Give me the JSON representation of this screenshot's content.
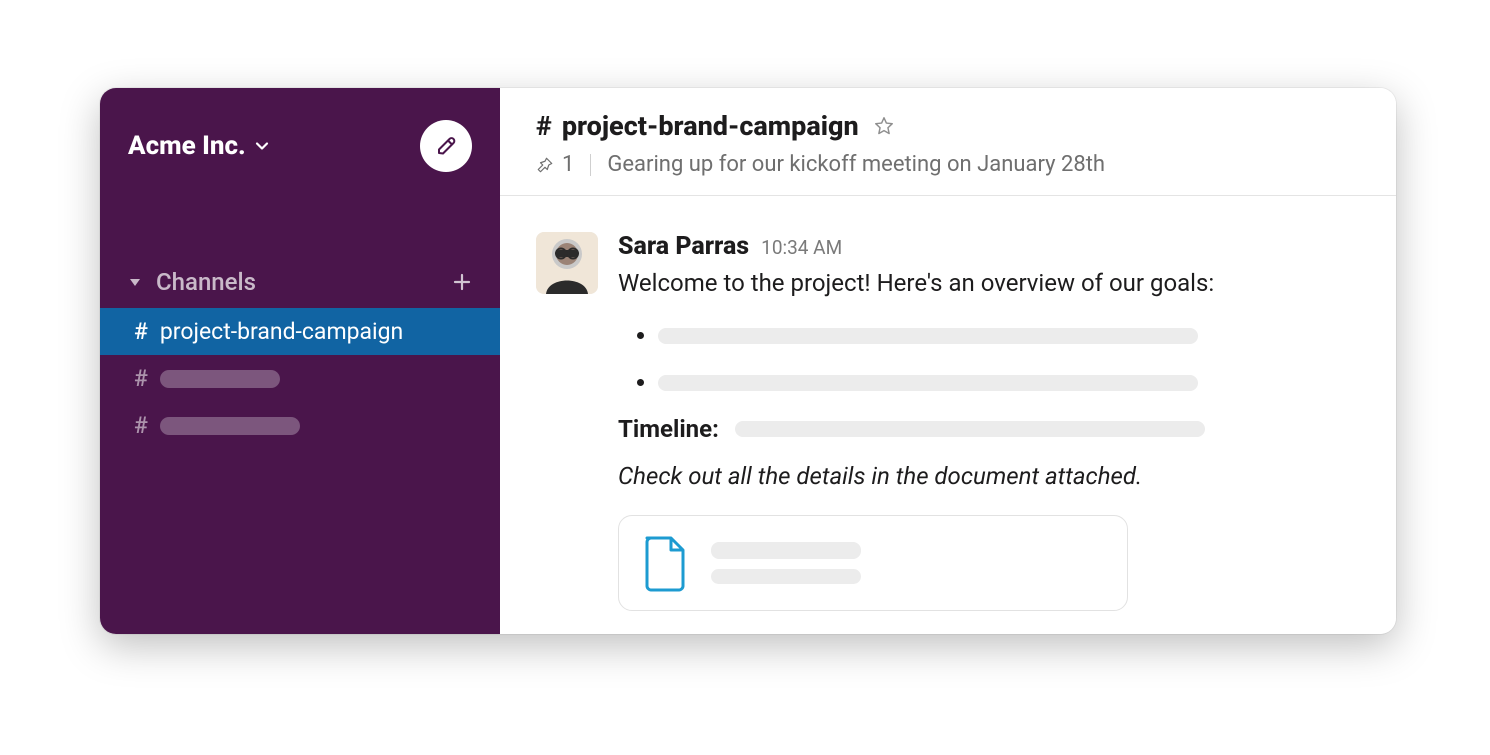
{
  "workspace": {
    "name": "Acme Inc."
  },
  "sidebar": {
    "section_label": "Channels",
    "channels": [
      {
        "name": "project-brand-campaign",
        "active": true
      }
    ]
  },
  "channel_header": {
    "name": "project-brand-campaign",
    "pinned_count": "1",
    "topic": "Gearing up for our kickoff meeting on January 28th"
  },
  "message": {
    "author": "Sara Parras",
    "time": "10:34 AM",
    "intro": "Welcome to the project! Here's an overview of our goals:",
    "timeline_label": "Timeline:",
    "footer_italic": "Check out all the details in the document attached."
  }
}
